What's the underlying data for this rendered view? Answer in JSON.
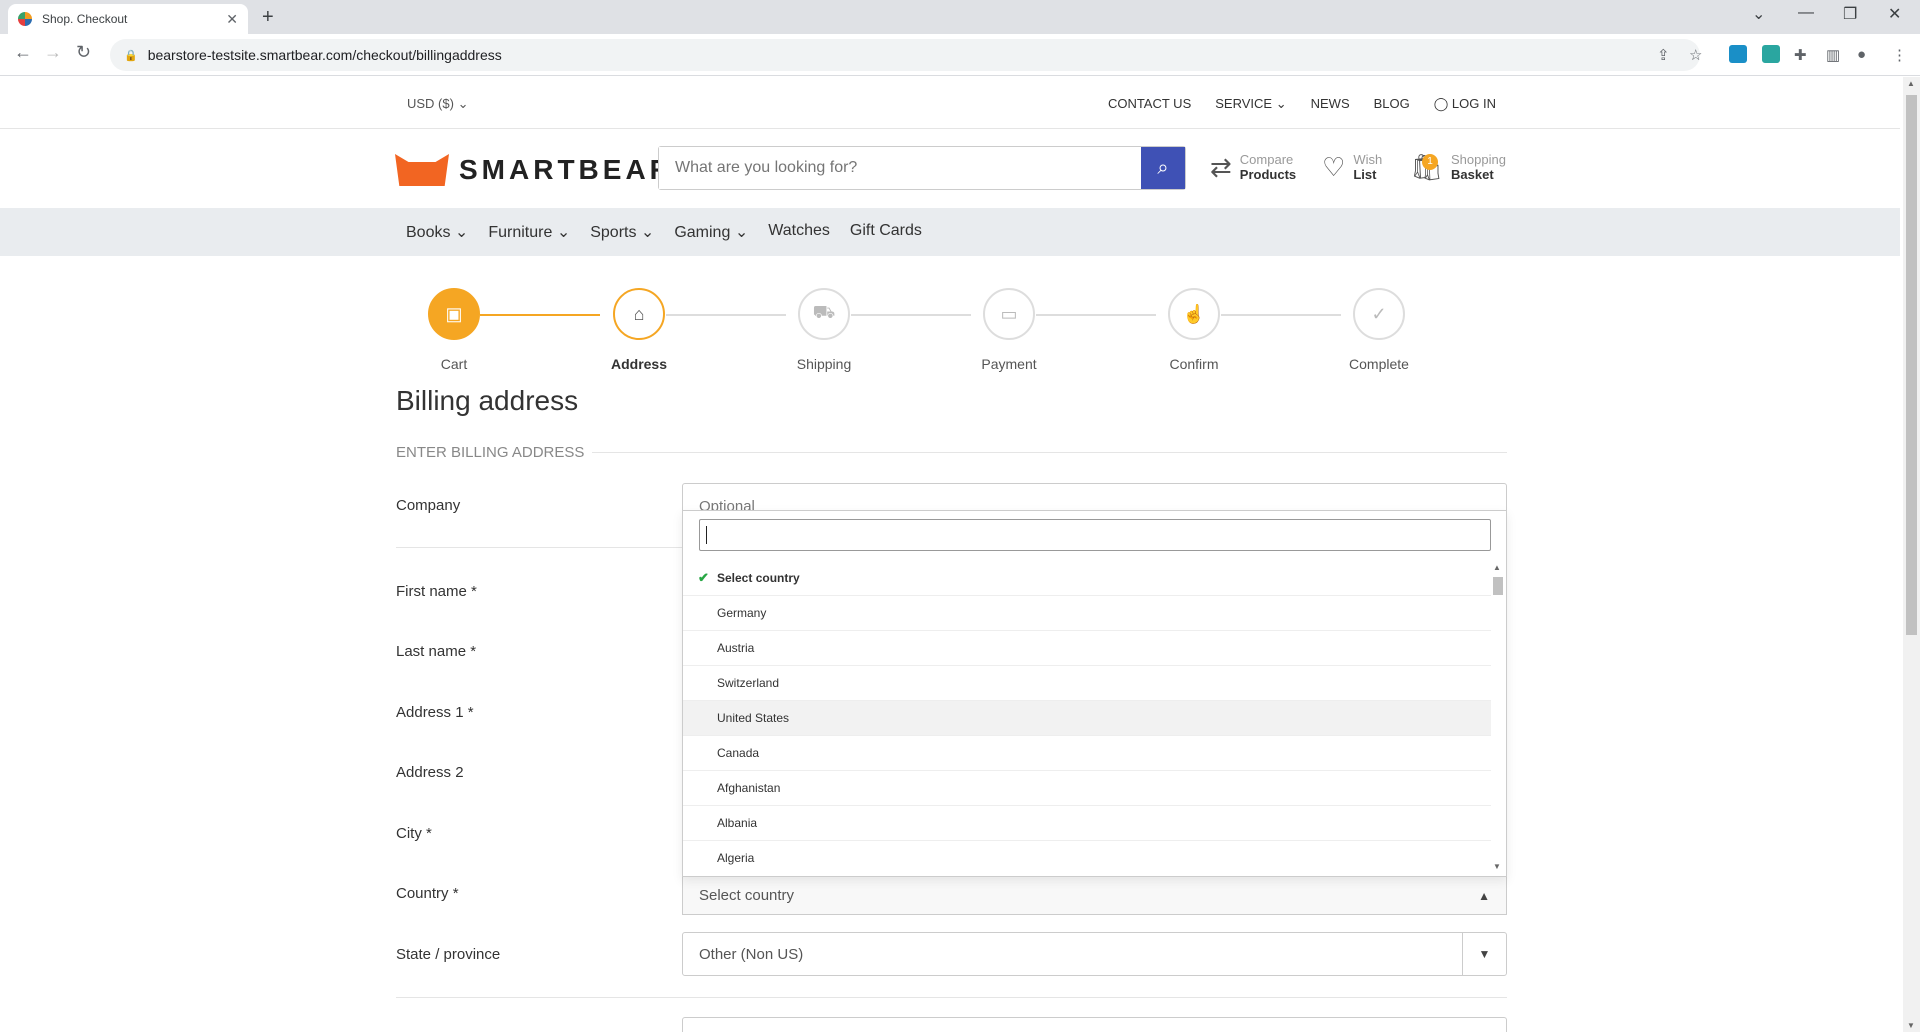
{
  "browser": {
    "tab_title": "Shop. Checkout",
    "url": "bearstore-testsite.smartbear.com/checkout/billingaddress"
  },
  "topbar": {
    "currency": "USD ($)",
    "links": [
      "CONTACT US",
      "SERVICE",
      "NEWS",
      "BLOG",
      "LOG IN"
    ]
  },
  "header": {
    "logo_text": "SMARTBEAR",
    "search_placeholder": "What are you looking for?",
    "compare_small": "Compare",
    "compare_big": "Products",
    "wish_small": "Wish",
    "wish_big": "List",
    "basket_small": "Shopping",
    "basket_big": "Basket",
    "basket_count": "1"
  },
  "categories": [
    "Books",
    "Furniture",
    "Sports",
    "Gaming",
    "Watches",
    "Gift Cards"
  ],
  "steps": [
    "Cart",
    "Address",
    "Shipping",
    "Payment",
    "Confirm",
    "Complete"
  ],
  "page": {
    "title": "Billing address",
    "section": "ENTER BILLING ADDRESS"
  },
  "form": {
    "company_label": "Company",
    "company_placeholder": "Optional",
    "first_name_label": "First name *",
    "last_name_label": "Last name *",
    "address1_label": "Address 1 *",
    "address2_label": "Address 2",
    "city_label": "City *",
    "country_label": "Country *",
    "country_value": "Select country",
    "state_label": "State / province",
    "state_value": "Other (Non US)"
  },
  "dropdown": {
    "options": [
      "Select country",
      "Germany",
      "Austria",
      "Switzerland",
      "United States",
      "Canada",
      "Afghanistan",
      "Albania",
      "Algeria"
    ],
    "selected": "Select country",
    "hovered": "United States"
  },
  "colors": {
    "accent": "#f5a623",
    "search_button": "#3f51b5",
    "logo": "#f26522",
    "check": "#28a745"
  }
}
